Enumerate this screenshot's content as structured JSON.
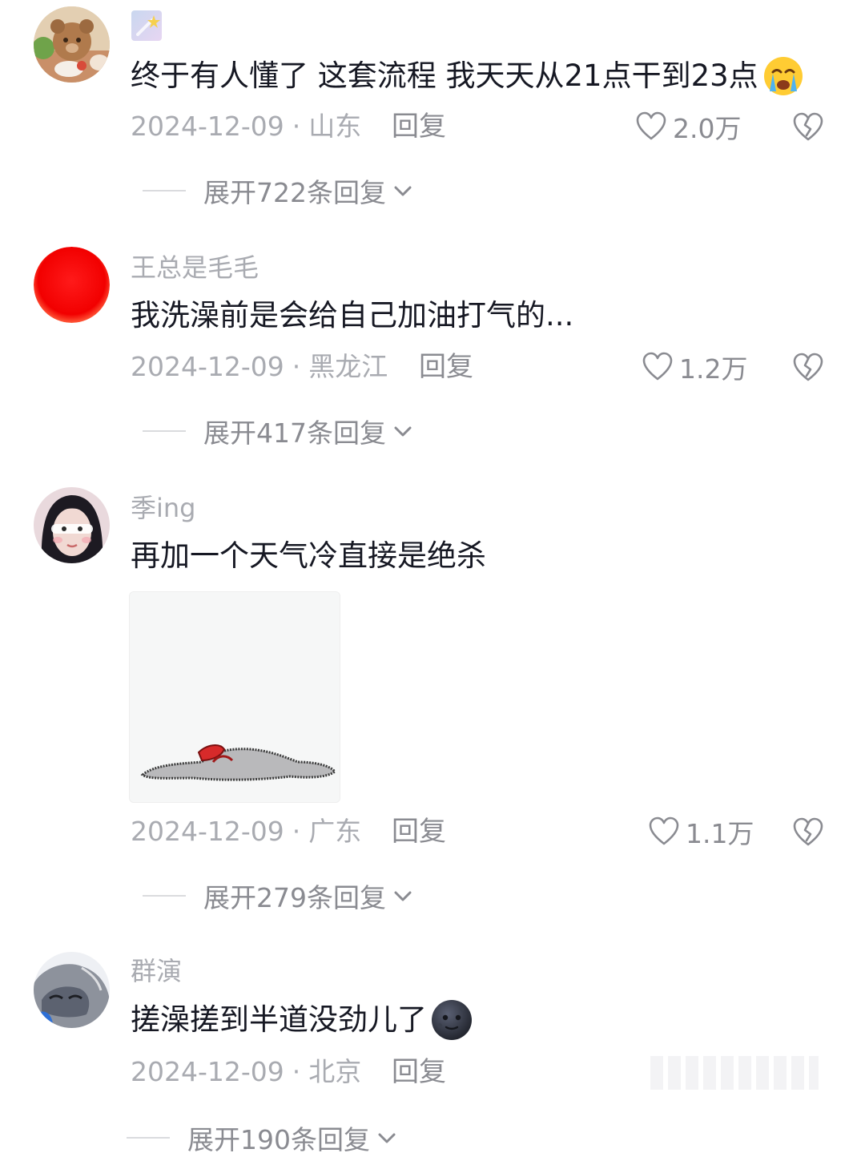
{
  "comments": [
    {
      "username": "",
      "text": "终于有人懂了 这套流程 我天天从21点干到23点",
      "date": "2024-12-09",
      "location": "山东",
      "reply_label": "回复",
      "likes": "2.0万",
      "expand_label": "展开722条回复",
      "avatar_icon": "teddy-bear-avatar",
      "emoji_icon": "crying-face-emoji"
    },
    {
      "username": "王总是毛毛",
      "text": "我洗澡前是会给自己加油打气的...",
      "date": "2024-12-09",
      "location": "黑龙江",
      "reply_label": "回复",
      "likes": "1.2万",
      "expand_label": "展开417条回复",
      "avatar_icon": "red-circle-avatar"
    },
    {
      "username": "季ing",
      "text": "再加一个天气冷直接是绝杀",
      "date": "2024-12-09",
      "location": "广东",
      "reply_label": "回复",
      "likes": "1.1万",
      "expand_label": "展开279条回复",
      "avatar_icon": "girl-photo-avatar",
      "sticker_icon": "lying-flat-creature-sticker"
    },
    {
      "username": "群演",
      "text": "搓澡搓到半道没劲儿了",
      "date": "2024-12-09",
      "location": "北京",
      "reply_label": "回复",
      "expand_label": "展开190条回复",
      "avatar_icon": "cartoon-character-avatar",
      "emoji_icon": "dark-moon-face-emoji"
    }
  ],
  "colors": {
    "text_primary": "#161823",
    "text_secondary": "#a9abb1",
    "text_action": "#8a8b91",
    "divider": "#dadbde"
  }
}
